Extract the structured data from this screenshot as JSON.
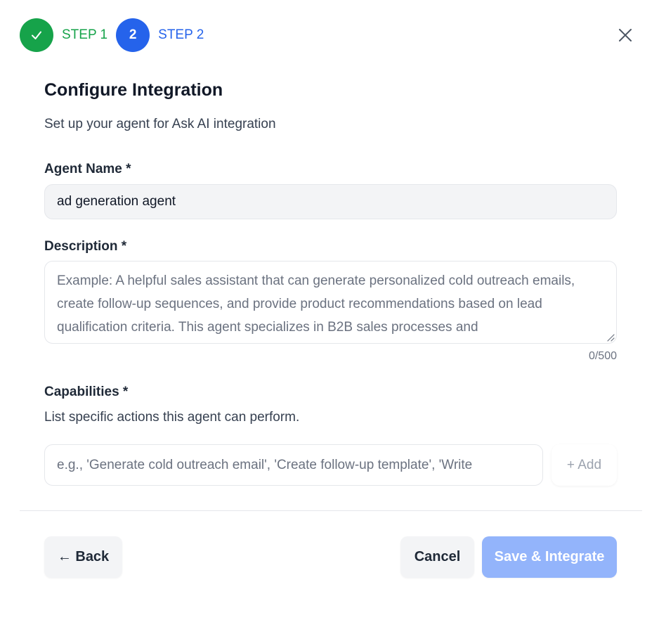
{
  "stepper": {
    "step1": {
      "number": "✓",
      "label": "STEP 1",
      "state": "completed",
      "color": "#16a34a"
    },
    "step2": {
      "number": "2",
      "label": "STEP 2",
      "state": "active",
      "color": "#2563eb"
    }
  },
  "close_icon": "close-icon",
  "header": {
    "title": "Configure Integration",
    "subtitle": "Set up your agent for Ask AI integration"
  },
  "form": {
    "agent_name": {
      "label": "Agent Name *",
      "value": "ad generation agent"
    },
    "description": {
      "label": "Description *",
      "value": "",
      "placeholder": "Example: A helpful sales assistant that can generate personalized cold outreach emails, create follow-up sequences, and provide product recommendations based on lead qualification criteria. This agent specializes in B2B sales processes and",
      "counter": "0/500"
    },
    "capabilities": {
      "label": "Capabilities *",
      "help": "List specific actions this agent can perform.",
      "placeholder": "e.g., 'Generate cold outreach email', 'Create follow-up template', 'Write",
      "add_label": "+ Add"
    }
  },
  "footer": {
    "back_label": "← Back",
    "cancel_label": "Cancel",
    "save_label": "Save & Integrate"
  },
  "colors": {
    "success": "#16a34a",
    "primary": "#2563eb",
    "primary_disabled": "#93b4fb"
  }
}
